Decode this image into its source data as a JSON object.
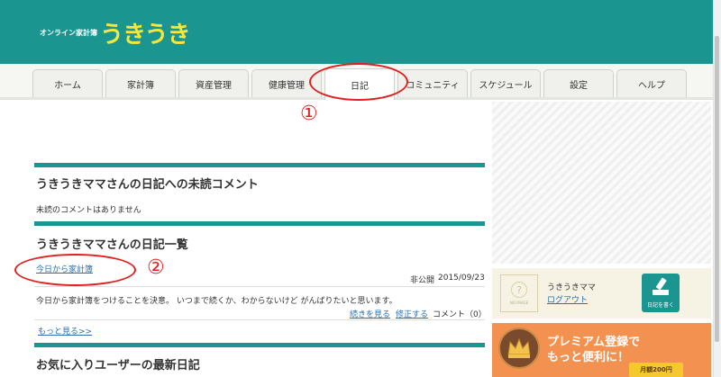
{
  "header": {
    "logo_small": "オンライン家計簿",
    "logo_big": "うきうき"
  },
  "tabs": [
    {
      "label": "ホーム"
    },
    {
      "label": "家計簿"
    },
    {
      "label": "資産管理"
    },
    {
      "label": "健康管理"
    },
    {
      "label": "日記",
      "active": true
    },
    {
      "label": "コミュニティ"
    },
    {
      "label": "スケジュール"
    },
    {
      "label": "設定"
    },
    {
      "label": "ヘルプ"
    }
  ],
  "annotations": {
    "num1": "①",
    "num2": "②",
    "color": "#e02020"
  },
  "unread": {
    "title": "うきうきママさんの日記への未読コメント",
    "message": "未読のコメントはありません"
  },
  "diary_list": {
    "title": "うきうきママさんの日記一覧",
    "entry": {
      "title": "今日から家計簿",
      "visibility": "非公開",
      "date": "2015/09/23",
      "body": "今日から家計簿をつけることを決意。 いつまで続くか、わからないけど がんばりたいと思います。",
      "read_more": "続きを見る",
      "edit": "修正する",
      "comment": "コメント（0）"
    },
    "more_link": "もっと見る>>"
  },
  "favorites": {
    "title": "お気に入りユーザーの最新日記"
  },
  "sidebar": {
    "no_image": "NO IMAGE",
    "no_image_glyph": "?",
    "user_name": "うきうきママ",
    "logout": "ログアウト",
    "write_button": "日記を書く",
    "premium_line1": "プレミアム登録で",
    "premium_line2": "もっと便利に！",
    "price": "月額200円"
  },
  "colors": {
    "brand_teal": "#1b9590",
    "logo_yellow": "#f7e63b",
    "link_blue": "#2a6fb0",
    "premium_orange": "#f39150"
  }
}
